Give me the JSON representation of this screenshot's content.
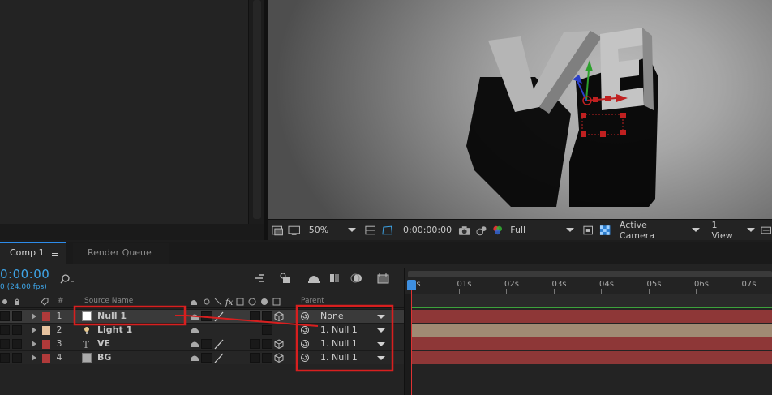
{
  "viewer": {
    "text_3d": "VE",
    "zoom": "50%",
    "timecode": "0:00:00:00",
    "resolution": "Full",
    "camera": "Active Camera",
    "views": "1 View"
  },
  "tabs": {
    "comp": "Comp 1",
    "render_queue": "Render Queue"
  },
  "timeline": {
    "timecode": "0:00:00",
    "fps": "0 (24.00 fps)",
    "ruler_ticks": [
      "0s",
      "01s",
      "02s",
      "03s",
      "04s",
      "05s",
      "06s",
      "07s"
    ],
    "columns": {
      "number": "#",
      "source_name": "Source Name",
      "parent": "Parent"
    },
    "layers": [
      {
        "num": "1",
        "name": "Null 1",
        "parent": "None",
        "label_color": "#b03a3a",
        "bar_color": "#8e3737",
        "type_icon": "null-icon"
      },
      {
        "num": "2",
        "name": "Light 1",
        "parent": "1. Null 1",
        "label_color": "#e6c29e",
        "bar_color": "#a08a73",
        "type_icon": "light-icon"
      },
      {
        "num": "3",
        "name": "VE",
        "parent": "1. Null 1",
        "label_color": "#b03a3a",
        "bar_color": "#8e3737",
        "type_icon": "text-icon"
      },
      {
        "num": "4",
        "name": "BG",
        "parent": "1. Null 1",
        "label_color": "#b03a3a",
        "bar_color": "#8e3737",
        "type_icon": "solid-icon"
      }
    ]
  },
  "colors": {
    "accent_blue": "#3ea5e8",
    "highlight_red": "#d81f1f",
    "workarea_green": "#3ca23c"
  }
}
